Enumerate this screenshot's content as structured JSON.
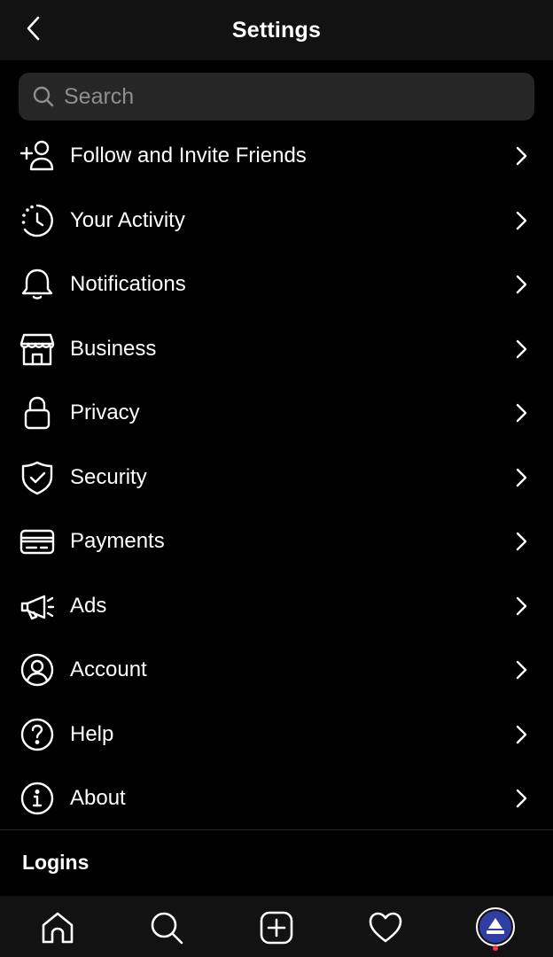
{
  "header": {
    "title": "Settings",
    "back_icon": "chevron-left-icon"
  },
  "search": {
    "placeholder": "Search",
    "value": "",
    "icon": "search-icon"
  },
  "menu": {
    "items": [
      {
        "label": "Follow and Invite Friends",
        "icon": "add-person-icon"
      },
      {
        "label": "Your Activity",
        "icon": "activity-clock-icon"
      },
      {
        "label": "Notifications",
        "icon": "bell-icon"
      },
      {
        "label": "Business",
        "icon": "storefront-icon"
      },
      {
        "label": "Privacy",
        "icon": "lock-icon"
      },
      {
        "label": "Security",
        "icon": "shield-check-icon"
      },
      {
        "label": "Payments",
        "icon": "credit-card-icon"
      },
      {
        "label": "Ads",
        "icon": "megaphone-icon"
      },
      {
        "label": "Account",
        "icon": "person-circle-icon"
      },
      {
        "label": "Help",
        "icon": "help-circle-icon"
      },
      {
        "label": "About",
        "icon": "info-circle-icon"
      }
    ]
  },
  "logins": {
    "title": "Logins"
  },
  "tabbar": {
    "items": [
      "home-icon",
      "search-icon",
      "create-icon",
      "heart-icon",
      "profile-avatar"
    ]
  },
  "colors": {
    "background": "#000000",
    "bar": "#121212",
    "search_bg": "#262626",
    "placeholder": "#8e8e8e",
    "avatar": "#2f3ea3",
    "notification_dot": "#ff3040"
  }
}
